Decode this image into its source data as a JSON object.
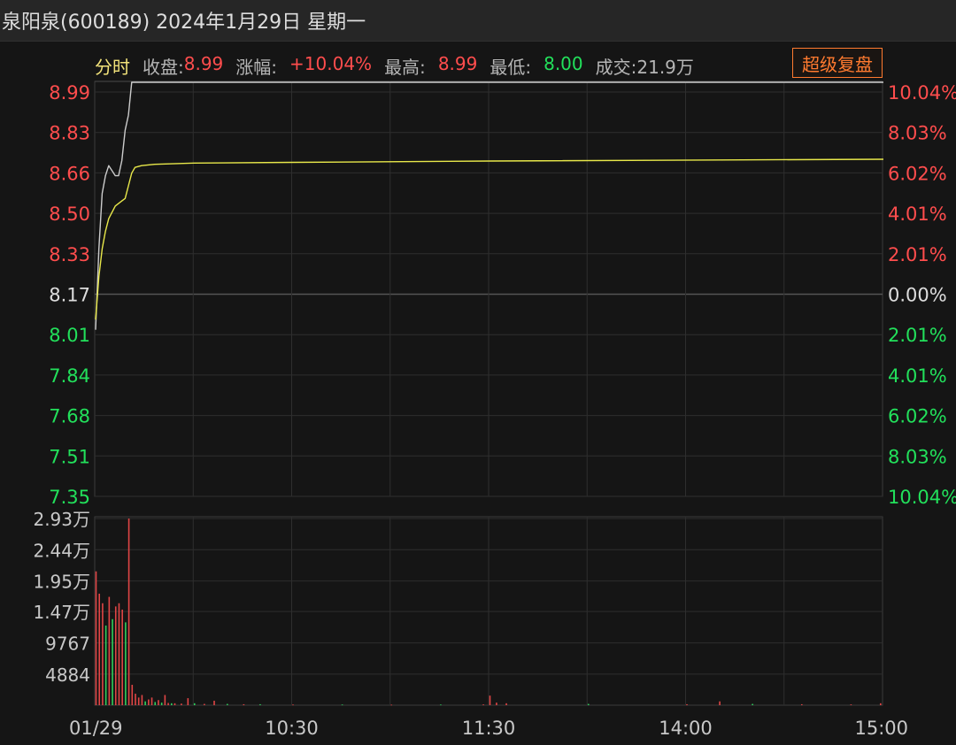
{
  "header": {
    "title": "泉阳泉(600189) 2024年1月29日 星期一"
  },
  "info_bar": {
    "mode_label": "分时",
    "close_label": "收盘:",
    "close_value": "8.99",
    "change_label": "涨幅:",
    "change_value": "+10.04%",
    "high_label": "最高:",
    "high_value": "8.99",
    "low_label": "最低:",
    "low_value": "8.00",
    "volume_label": "成交:",
    "volume_value": "21.9万"
  },
  "toolbar": {
    "replay_button": "超级复盘"
  },
  "colors": {
    "up": "#ff4d4d",
    "down": "#22e05b",
    "flat": "#dddddd",
    "price_line": "#cccccc",
    "avg_line": "#e8e84a",
    "accent": "#ff7a2f",
    "mode_label": "#f2e27a"
  },
  "chart_data": {
    "type": "line",
    "title": "",
    "x_ticks": [
      "01/29",
      "10:30",
      "11:30",
      "14:00",
      "15:00"
    ],
    "price_axis": {
      "reference": 8.17,
      "ylim": [
        7.35,
        8.99
      ],
      "ticks": [
        "8.99",
        "8.83",
        "8.66",
        "8.50",
        "8.33",
        "8.17",
        "8.01",
        "7.84",
        "7.68",
        "7.51",
        "7.35"
      ],
      "pct_ticks": [
        "10.04%",
        "8.03%",
        "6.02%",
        "4.01%",
        "2.01%",
        "0.00%",
        "2.01%",
        "4.01%",
        "6.02%",
        "8.03%",
        "10.04%"
      ]
    },
    "series": [
      {
        "name": "price",
        "x_minutes": [
          0,
          1,
          2,
          3,
          4,
          5,
          6,
          7,
          8,
          9,
          10,
          11,
          12,
          240
        ],
        "values": [
          8.01,
          8.33,
          8.55,
          8.62,
          8.66,
          8.64,
          8.62,
          8.62,
          8.68,
          8.8,
          8.86,
          8.99,
          8.99,
          8.99
        ]
      },
      {
        "name": "avg",
        "x_minutes": [
          0,
          1,
          2,
          3,
          4,
          6,
          8,
          9,
          10,
          11,
          12,
          14,
          18,
          30,
          60,
          120,
          240
        ],
        "values": [
          8.05,
          8.22,
          8.33,
          8.4,
          8.45,
          8.5,
          8.52,
          8.53,
          8.58,
          8.63,
          8.653,
          8.66,
          8.665,
          8.67,
          8.673,
          8.678,
          8.685
        ]
      }
    ],
    "volume_axis": {
      "ylim": [
        0,
        29300
      ],
      "ticks": [
        "2.93万",
        "2.44万",
        "1.95万",
        "1.47万",
        "9767",
        "4884"
      ],
      "tick_values": [
        29300,
        24400,
        19500,
        14700,
        9767,
        4884
      ]
    },
    "volume": {
      "x_minutes": [
        0,
        1,
        2,
        3,
        4,
        5,
        6,
        7,
        8,
        9,
        10,
        11,
        12,
        13,
        14,
        15,
        16,
        17,
        18,
        19,
        20,
        21,
        22,
        23,
        24,
        26,
        28,
        30,
        33,
        36,
        40,
        45,
        50,
        60,
        75,
        90,
        105,
        118,
        120,
        122,
        125,
        150,
        180,
        190,
        200,
        215,
        230,
        239
      ],
      "values": [
        21000,
        17500,
        16000,
        12500,
        17000,
        13500,
        15500,
        16000,
        15000,
        13000,
        29300,
        3200,
        1800,
        1200,
        1600,
        600,
        900,
        1200,
        500,
        800,
        400,
        1600,
        350,
        300,
        300,
        250,
        1100,
        300,
        200,
        700,
        200,
        150,
        150,
        100,
        100,
        80,
        100,
        120,
        1500,
        400,
        300,
        200,
        150,
        600,
        200,
        150,
        120,
        300
      ],
      "colors": [
        "up",
        "up",
        "up",
        "down",
        "up",
        "down",
        "up",
        "up",
        "up",
        "down",
        "up",
        "up",
        "up",
        "up",
        "up",
        "down",
        "up",
        "up",
        "down",
        "up",
        "down",
        "up",
        "up",
        "down",
        "up",
        "up",
        "up",
        "down",
        "up",
        "up",
        "down",
        "up",
        "down",
        "up",
        "down",
        "up",
        "down",
        "up",
        "up",
        "up",
        "up",
        "down",
        "up",
        "up",
        "down",
        "up",
        "up",
        "up"
      ]
    }
  }
}
